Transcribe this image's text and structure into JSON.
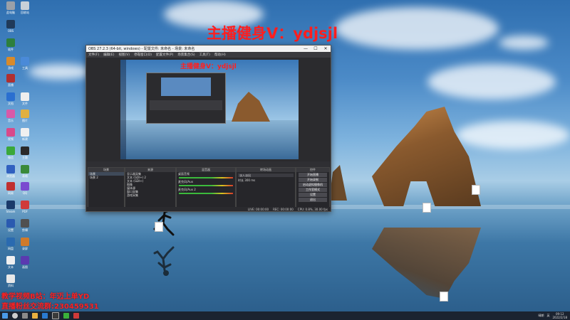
{
  "overlay_title": "主播健身V：ydjsjl",
  "caption": {
    "line1": "教学视频B站：年迈上单YD",
    "line2": "直播粉丝交流群:230459531"
  },
  "obs": {
    "title": "OBS 27.2.3 (64-bit, windows) - 配置文件: 未命名 - 场景: 未命名",
    "window_buttons": [
      "—",
      "☐",
      "✕"
    ],
    "menu": [
      "文件(F)",
      "编辑(E)",
      "视图(V)",
      "停靠窗口(D)",
      "配置文件(P)",
      "场景集合(S)",
      "工具(T)",
      "帮助(H)"
    ],
    "preview_title": "主播健身V：ydjsjl",
    "preview_info_label": "未选择源",
    "docks": {
      "scenes": {
        "title": "场景",
        "items": [
          "场景",
          "场景 2"
        ]
      },
      "sources": {
        "title": "来源",
        "items": [
          "显示器采集",
          "文本 (GDI+) 2",
          "文本 (GDI+)",
          "图像",
          "媒体源",
          "窗口采集",
          "游戏采集"
        ]
      },
      "mixer": {
        "title": "混音器",
        "channels": [
          "桌面音频",
          "麦克风/Aux",
          "麦克风/Aux 2"
        ]
      },
      "transitions": {
        "title": "转场动画",
        "type": "淡入淡出",
        "duration_label": "时长",
        "duration": "300 ms"
      },
      "controls": {
        "title": "控件",
        "buttons": [
          "开始直播",
          "开始录制",
          "启动虚拟摄像机",
          "工作室模式",
          "设置",
          "退出"
        ]
      }
    },
    "status": {
      "live": "LIVE: 00:00:00",
      "rec": "REC: 00:00:00",
      "cpu": "CPU: 0.8%, 30.00 fps"
    }
  },
  "taskbar": {
    "time": "09:12",
    "date": "2022/2/18",
    "ime": "英",
    "weather": "晴朗"
  },
  "colors": {
    "accent_red": "#ff1e1e",
    "obs_bg": "#2b2b2e",
    "taskbar": "#1b2330"
  }
}
